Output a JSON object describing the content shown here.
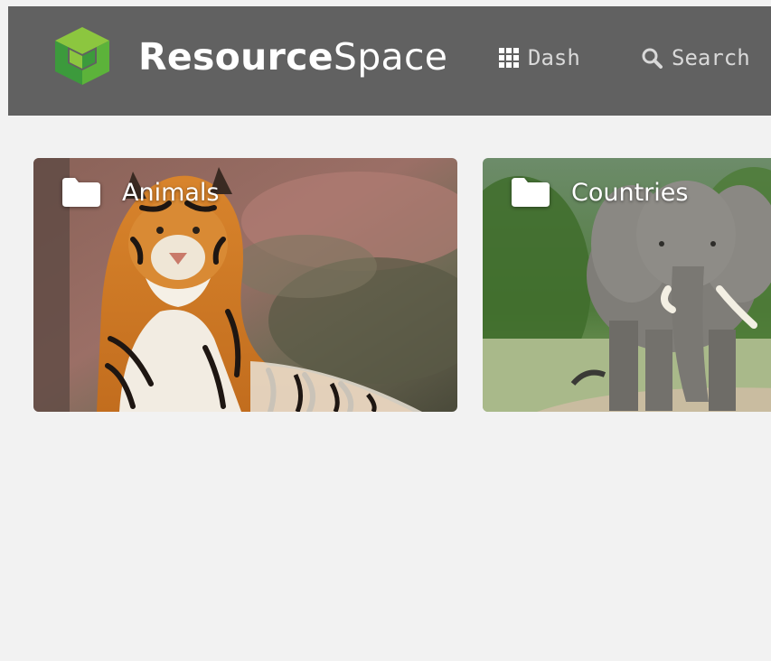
{
  "header": {
    "brand_bold": "Resource",
    "brand_light": "Space",
    "logo_icon": "resourcespace-cube-logo-icon",
    "nav": [
      {
        "label": "Dash",
        "icon": "grid-icon"
      },
      {
        "label": "Search",
        "icon": "search-icon"
      }
    ]
  },
  "tiles": [
    {
      "label": "Animals",
      "icon": "folder-icon",
      "image": "tiger-photo"
    },
    {
      "label": "Countries",
      "icon": "folder-icon",
      "image": "elephant-photo"
    }
  ],
  "colors": {
    "header_bg": "#616161",
    "page_bg": "#f2f2f2",
    "logo_green_light": "#8cc63f",
    "logo_green_dark": "#3c9a3c",
    "nav_text": "#d9d9d9"
  }
}
